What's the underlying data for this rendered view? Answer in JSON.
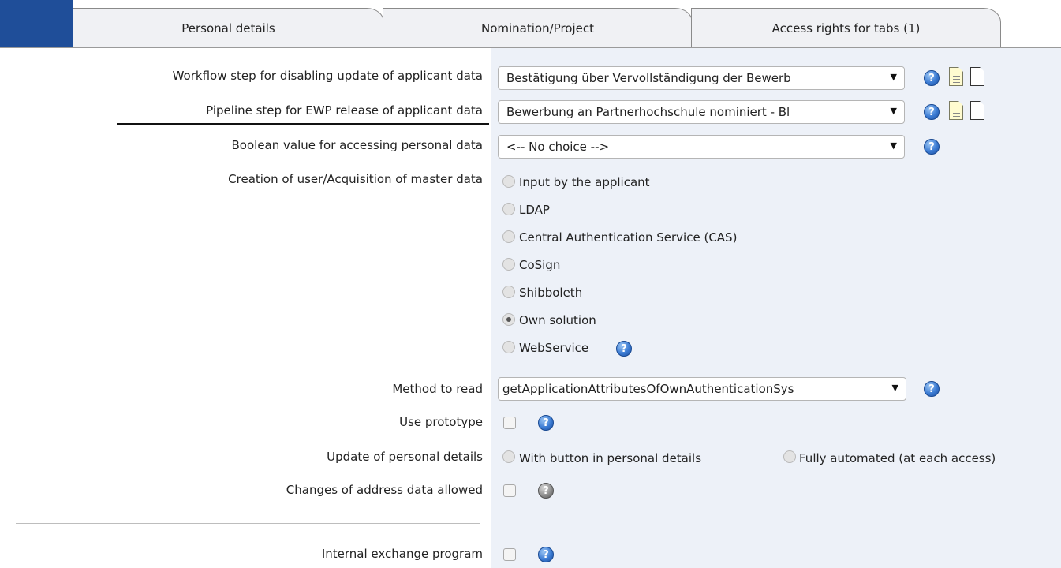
{
  "tabs": [
    {
      "label": "Personal details"
    },
    {
      "label": "Nomination/Project"
    },
    {
      "label": "Access rights for tabs (1)"
    }
  ],
  "fields": {
    "workflow_step": {
      "label": "Workflow step for disabling update of applicant data",
      "value": "Bestätigung über Vervollständigung der Bewerb"
    },
    "pipeline_step": {
      "label": "Pipeline step for EWP release of applicant data",
      "value": "Bewerbung an Partnerhochschule nominiert - Bl"
    },
    "boolean_value": {
      "label": "Boolean value for accessing personal data",
      "value": "<-- No choice -->"
    },
    "creation": {
      "label": "Creation of user/Acquisition of master data",
      "options": [
        "Input by the applicant",
        "LDAP",
        "Central Authentication Service (CAS)",
        "CoSign",
        "Shibboleth",
        "Own solution",
        "WebService"
      ],
      "selected": "Own solution"
    },
    "method_to_read": {
      "label": "Method to read",
      "value": "getApplicationAttributesOfOwnAuthenticationSys"
    },
    "use_prototype": {
      "label": "Use prototype",
      "checked": false
    },
    "update_personal": {
      "label": "Update of personal details",
      "options": [
        "With button in personal details",
        "Fully automated (at each access)"
      ]
    },
    "address_changes": {
      "label": "Changes of address data allowed",
      "checked": false
    },
    "internal_exchange": {
      "label": "Internal exchange program",
      "checked": false
    }
  },
  "icons": {
    "help": "help-icon",
    "doc_filled": "document-text-icon",
    "doc_blank": "document-blank-icon"
  },
  "colors": {
    "accent_tab": "#1f4e99",
    "form_bg": "#edf1f8",
    "help_blue": "#3b7bd3"
  }
}
